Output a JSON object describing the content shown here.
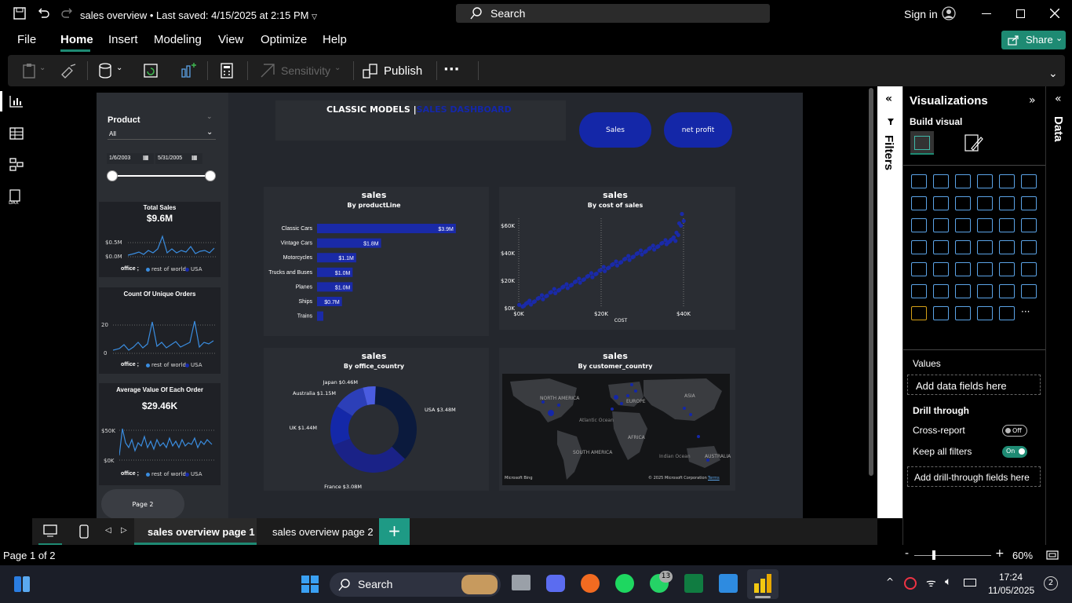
{
  "titlebar": {
    "doc_title": "sales overview",
    "saved": "Last saved: 4/15/2025 at 2:15 PM",
    "search": "Search",
    "signin": "Sign in"
  },
  "menu": [
    "File",
    "Home",
    "Insert",
    "Modeling",
    "View",
    "Optimize",
    "Help"
  ],
  "share": "Share",
  "ribbon": {
    "sensitivity": "Sensitivity",
    "publish": "Publish",
    "more": "···"
  },
  "report": {
    "header_bold": "CLASSIC MODELS |",
    "header_blue": "SALES DASHBOARD",
    "btn_sales": "Sales",
    "btn_profit": "net profit",
    "slicer": {
      "title": "Product",
      "value": "All",
      "date_from": "1/6/2003",
      "date_to": "5/31/2005"
    },
    "kpi1": {
      "title": "Total Sales",
      "value": "$9.6M",
      "y1": "$0.5M",
      "y0": "$0.0M",
      "legend_label": "office ;",
      "leg1": "rest of world",
      "leg2": "USA"
    },
    "kpi2": {
      "title": "Count Of Unique Orders",
      "y1": "20",
      "y0": "0",
      "legend_label": "office ;",
      "leg1": "rest of world",
      "leg2": "USA"
    },
    "kpi3": {
      "title": "Average Value Of Each Order",
      "value": "$29.46K",
      "y1": "$50K",
      "y0": "$0K",
      "legend_label": "office ;",
      "leg1": "rest of world",
      "leg2": "USA"
    },
    "page2_btn": "Page 2",
    "bar": {
      "title": "sales",
      "subtitle": "By productLine"
    },
    "scatter": {
      "title": "sales",
      "subtitle": "By cost of sales",
      "xlabel": "COST",
      "yticks": [
        "$60K",
        "$40K",
        "$20K",
        "$0K"
      ],
      "xticks": [
        "$0K",
        "$20K",
        "$40K"
      ]
    },
    "donut": {
      "title": "sales",
      "subtitle": "By office_country"
    },
    "map": {
      "title": "sales",
      "subtitle": "By customer_country",
      "labels": [
        "NORTH AMERICA",
        "EUROPE",
        "ASIA",
        "Atlantic Ocean",
        "AFRICA",
        "SOUTH AMERICA",
        "Indian Ocean",
        "AUSTRALIA"
      ],
      "credit_left": "Microsoft Bing",
      "credit_right": "© 2025 Microsoft Corporation",
      "terms": "Terms"
    }
  },
  "chart_data": [
    {
      "type": "bar",
      "title": "sales",
      "subtitle": "By productLine",
      "categories": [
        "Classic Cars",
        "Vintage Cars",
        "Motorcycles",
        "Trucks and Buses",
        "Planes",
        "Ships",
        "Trains"
      ],
      "values": [
        3.9,
        1.8,
        1.1,
        1.0,
        1.0,
        0.7,
        0.1
      ],
      "labels": [
        "$3.9M",
        "$1.8M",
        "$1.1M",
        "$1.0M",
        "$1.0M",
        "$0.7M",
        ""
      ],
      "xlim": [
        0,
        4.3
      ]
    },
    {
      "type": "pie",
      "title": "sales",
      "subtitle": "By office_country",
      "categories": [
        "USA",
        "France",
        "UK",
        "Australia",
        "Japan"
      ],
      "values": [
        3.48,
        3.08,
        1.44,
        1.15,
        0.46
      ],
      "labels": [
        "USA $3.48M",
        "France $3.08M",
        "UK $1.44M",
        "Australia $1.15M",
        "Japan $0.46M"
      ],
      "colors": [
        "#0b1a3d",
        "#1a2287",
        "#1428a8",
        "#2c3fb8",
        "#4a5ce0"
      ]
    },
    {
      "type": "scatter",
      "title": "sales",
      "subtitle": "By cost of sales",
      "xlabel": "COST",
      "xlim": [
        0,
        40000
      ],
      "ylim": [
        0,
        65000
      ],
      "x": [
        500,
        3000,
        6000,
        9000,
        12000,
        15000,
        18000,
        21000,
        24000,
        27000,
        30000,
        33000,
        36000,
        38000,
        40000
      ],
      "y": [
        1000,
        4000,
        8000,
        12500,
        16000,
        20000,
        24000,
        28500,
        32500,
        36500,
        40500,
        44000,
        48000,
        50000,
        67000
      ]
    }
  ],
  "vis": {
    "title": "Visualizations",
    "build": "Build visual",
    "values": "Values",
    "add_fields": "Add data fields here",
    "drill": "Drill through",
    "cross": "Cross-report",
    "cross_state": "Off",
    "keep": "Keep all filters",
    "keep_state": "On",
    "add_drill": "Add drill-through fields here",
    "ellipsis": "···"
  },
  "filters_label": "Filters",
  "data_label": "Data",
  "tabs": {
    "page1": "sales overview page 1",
    "page2": "sales overview page 2",
    "add": "+"
  },
  "status": {
    "page": "Page 1 of 2",
    "zoom": "60%",
    "zoom_minus": "-",
    "zoom_plus": "+"
  },
  "taskbar": {
    "search": "Search",
    "time": "17:24",
    "date": "11/05/2025",
    "wa_badge": "13",
    "notif": "2"
  },
  "colors": {
    "accent": "#1427a8",
    "teal": "#1e8a73",
    "line": "#3a8de0"
  }
}
